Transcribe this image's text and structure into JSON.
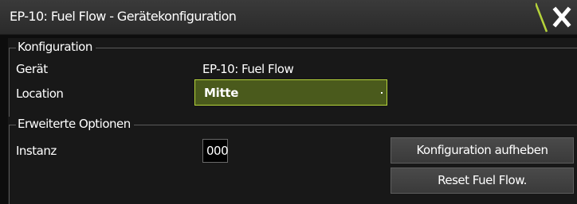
{
  "dialog": {
    "title": "EP-10: Fuel Flow - Gerätekonfiguration",
    "close_icon": "close-x-icon",
    "accent_color": "#b5d33a"
  },
  "konfiguration": {
    "group_title": "Konfiguration",
    "geraet_label": "Gerät",
    "geraet_value": "EP-10: Fuel Flow",
    "location_label": "Location",
    "location_selected": "Mitte"
  },
  "erweiterte_optionen": {
    "group_title": "Erweiterte Optionen",
    "instanz_label": "Instanz",
    "instanz_value": "000",
    "button_konfiguration_aufheben": "Konfiguration aufheben",
    "button_reset_fuel_flow": "Reset Fuel Flow."
  }
}
